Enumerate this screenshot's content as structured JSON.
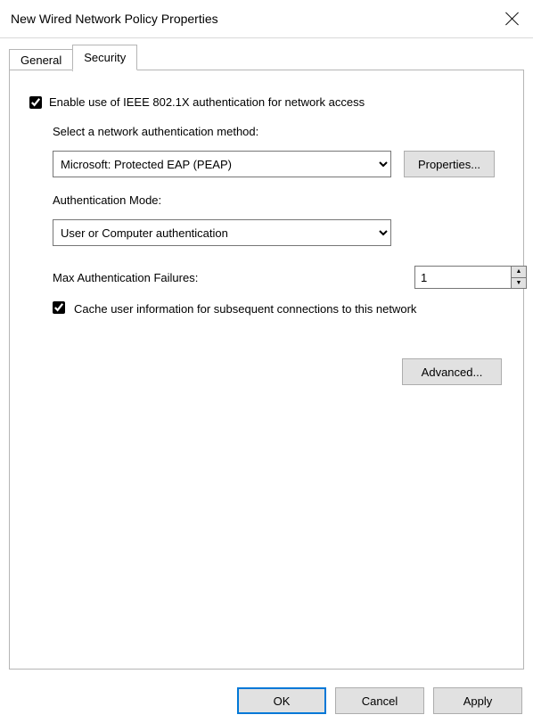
{
  "window": {
    "title": "New Wired Network Policy Properties"
  },
  "tabs": {
    "general": "General",
    "security": "Security"
  },
  "security": {
    "enable_8021x_label": "Enable use of IEEE 802.1X authentication for network access",
    "enable_8021x_checked": true,
    "auth_method_label": "Select a network authentication method:",
    "auth_method_value": "Microsoft: Protected EAP (PEAP)",
    "properties_btn": "Properties...",
    "auth_mode_label": "Authentication Mode:",
    "auth_mode_value": "User or Computer authentication",
    "max_failures_label": "Max Authentication Failures:",
    "max_failures_value": "1",
    "cache_label": "Cache user information for subsequent connections to this network",
    "cache_checked": true,
    "advanced_btn": "Advanced..."
  },
  "buttons": {
    "ok": "OK",
    "cancel": "Cancel",
    "apply": "Apply"
  }
}
